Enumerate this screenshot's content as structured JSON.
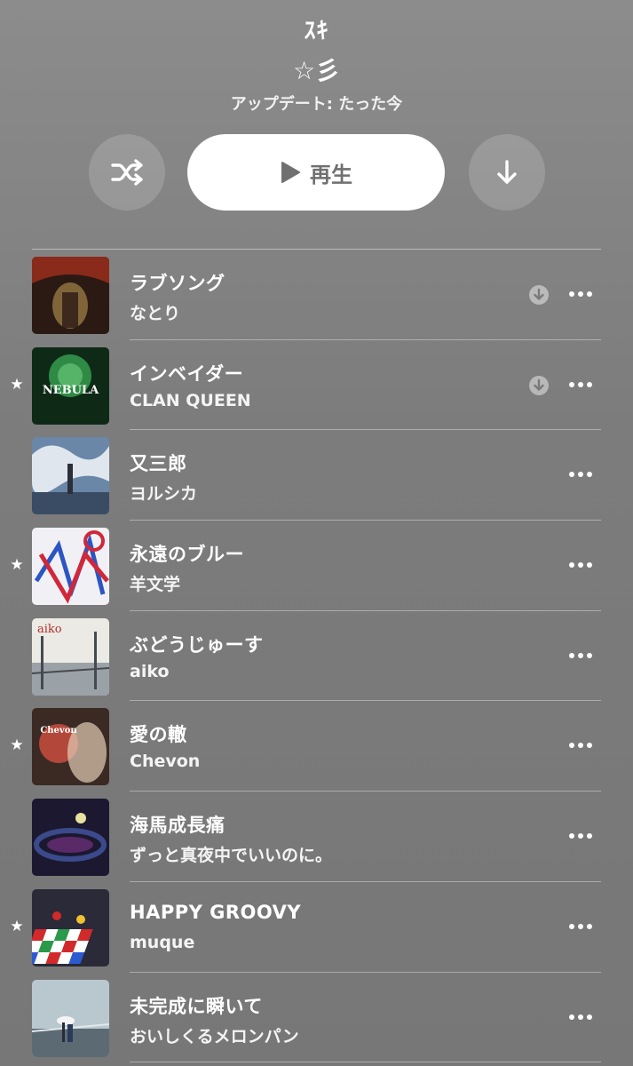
{
  "playlist": {
    "title": "ｽｷ",
    "subtitle": "☆彡",
    "updated": "アップデート: たった今"
  },
  "controls": {
    "play_label": "再生"
  },
  "tracks": [
    {
      "title": "ラブソング",
      "artist": "なとり",
      "favorite": false,
      "downloaded": true,
      "art": [
        "#2b1a14",
        "#8a2a1a",
        "#c9a45a"
      ]
    },
    {
      "title": "インベイダー",
      "artist": "CLAN QUEEN",
      "favorite": true,
      "downloaded": true,
      "art": [
        "#0e2a16",
        "#2f8a45",
        "#6fd07f"
      ],
      "art_text": "NEBULA"
    },
    {
      "title": "又三郎",
      "artist": "ヨルシカ",
      "favorite": false,
      "downloaded": false,
      "art": [
        "#6a87a8",
        "#dfe6ee",
        "#3a4c63"
      ]
    },
    {
      "title": "永遠のブルー",
      "artist": "羊文学",
      "favorite": true,
      "downloaded": false,
      "art": [
        "#f1f1f5",
        "#2c55c4",
        "#d0283a"
      ]
    },
    {
      "title": "ぶどうじゅーす",
      "artist": "aiko",
      "favorite": false,
      "downloaded": false,
      "art": [
        "#eceae4",
        "#9aa2a8",
        "#444a4f"
      ],
      "art_text": "aiko"
    },
    {
      "title": "愛の轍",
      "artist": "Chevon",
      "favorite": true,
      "downloaded": false,
      "art": [
        "#3b2a24",
        "#b3483a",
        "#e4cdb6"
      ],
      "art_text": "Chevon"
    },
    {
      "title": "海馬成長痛",
      "artist": "ずっと真夜中でいいのに。",
      "favorite": false,
      "downloaded": false,
      "art": [
        "#1b1830",
        "#3a4a8a",
        "#9a3aa0"
      ]
    },
    {
      "title": "HAPPY GROOVY",
      "artist": "muque",
      "favorite": true,
      "downloaded": false,
      "art": [
        "#2a2a38",
        "#d22a2a",
        "#2a9a4a"
      ]
    },
    {
      "title": "未完成に瞬いて",
      "artist": "おいしくるメロンパン",
      "favorite": false,
      "downloaded": false,
      "art": [
        "#b9c8cf",
        "#5c6b73",
        "#e2e8ea"
      ]
    }
  ],
  "icons": {
    "shuffle": "shuffle-icon",
    "play": "play-icon",
    "download": "download-icon",
    "favorite": "star-icon",
    "downloaded": "downloaded-icon",
    "more": "more-icon"
  }
}
